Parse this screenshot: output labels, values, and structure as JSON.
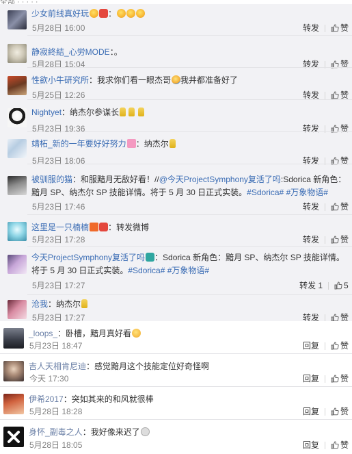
{
  "top_cut_text": "全部  ·  ·  ·  ·  ·",
  "actions": {
    "repost": "转发",
    "like": "赞",
    "reply": "回复"
  },
  "reposts": [
    {
      "user": "少女前线真好玩",
      "text": "：",
      "time": "5月28日 16:00",
      "repost_label": "转发",
      "like_label": "赞"
    },
    {
      "user": "静寂終結_心労MODE",
      "text": "：。",
      "time": "5月28日 15:04",
      "repost_label": "转发",
      "like_label": "赞"
    },
    {
      "user": "性欲小牛研究所",
      "text": "：我求你们看一眼杰哥",
      "text_after": "我井都准备好了",
      "time": "5月25日 12:26",
      "repost_label": "转发",
      "like_label": "赞"
    },
    {
      "user": "Nightyet",
      "text": "：纳杰尔参谋长",
      "time": "5月23日 19:36",
      "repost_label": "转发",
      "like_label": "赞"
    },
    {
      "user": "靖柘_新的一年要好好努力",
      "text": "：纳杰尔",
      "time": "5月23日 18:06",
      "repost_label": "转发",
      "like_label": "赞"
    },
    {
      "user": "被驯服的猫",
      "text": "：和服黯月无敌好看！//",
      "mention": "@今天ProjectSymphony复活了吗",
      "text2": ":Sdorica 新角色：",
      "line2": "黯月 SP、纳杰尔 SP 技能详情。将于 5 月 30 日正式实装。",
      "topics": [
        "#Sdorica#",
        "#万象物语#"
      ],
      "time": "5月23日 17:46",
      "repost_label": "转发",
      "like_label": "赞"
    },
    {
      "user": "这里是一只楠楠",
      "text": "：转发微博",
      "time": "5月23日 17:28",
      "repost_label": "转发",
      "like_label": "赞"
    },
    {
      "user": "今天ProjectSymphony复活了吗",
      "text": "：Sdorica 新角色：黯月 SP、纳杰尔 SP 技能详情。",
      "line2": "将于 5 月 30 日正式实装。",
      "topics": [
        "#Sdorica#",
        "#万象物语#"
      ],
      "time": "5月23日 17:27",
      "repost_label": "转发 1",
      "like_label": "5"
    },
    {
      "user": "沧我",
      "text": "：纳杰尔",
      "time": "5月23日 17:27",
      "repost_label": "转发",
      "like_label": "赞"
    }
  ],
  "comments": [
    {
      "user": "_loops_",
      "text": "：卧槽，黯月真好看",
      "time": "5月23日 18:47",
      "reply_label": "回复",
      "like_label": "赞"
    },
    {
      "user": "吉人天相肯尼迪",
      "text": "：感觉黯月这个技能定位好奇怪啊",
      "time": "今天 17:30",
      "reply_label": "回复",
      "like_label": "赞"
    },
    {
      "user": "伊希2017",
      "text": "：突如其来的和风就很棒",
      "time": "5月28日 18:28",
      "reply_label": "回复",
      "like_label": "赞"
    },
    {
      "user": "身怀_副毒之人",
      "text": "：我好像来迟了",
      "time": "5月28日 18:05",
      "reply_label": "回复",
      "like_label": "赞"
    }
  ],
  "colors": {
    "username": "#eb7350",
    "link": "#3a6cb4",
    "time": "#808080",
    "repost_bg": "#f2f2f5"
  }
}
